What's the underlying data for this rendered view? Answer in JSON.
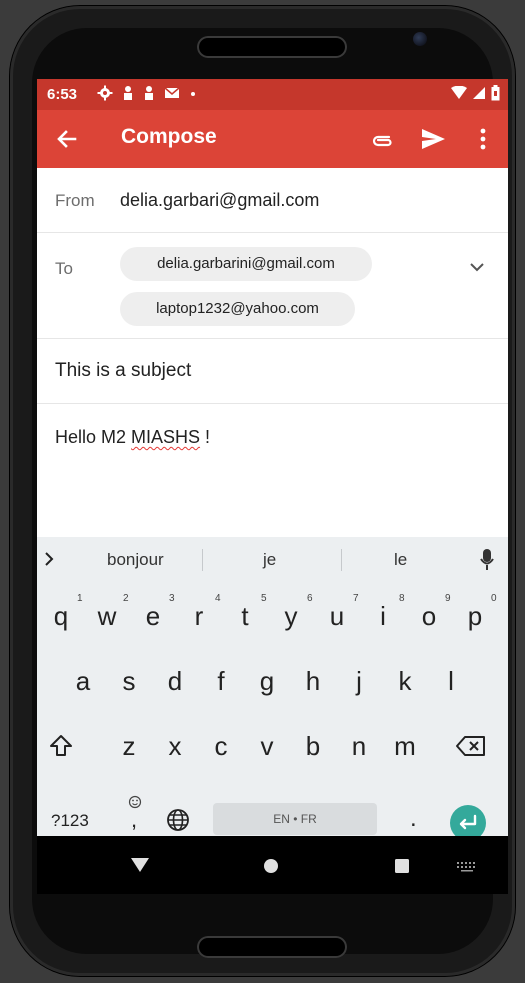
{
  "status_bar": {
    "time": "6:53"
  },
  "app_bar": {
    "title": "Compose"
  },
  "compose": {
    "from_label": "From",
    "from_value": "delia.garbari@gmail.com",
    "to_label": "To",
    "recipients": [
      "delia.garbarini@gmail.com",
      "laptop1232@yahoo.com"
    ],
    "subject": "This is a subject",
    "body_prefix": "Hello M2 ",
    "body_misspelled": "MIASHS",
    "body_suffix": " !"
  },
  "keyboard": {
    "suggestions": [
      "bonjour",
      "je",
      "le"
    ],
    "row1": [
      "q",
      "w",
      "e",
      "r",
      "t",
      "y",
      "u",
      "i",
      "o",
      "p"
    ],
    "row1_hints": [
      "1",
      "2",
      "3",
      "4",
      "5",
      "6",
      "7",
      "8",
      "9",
      "0"
    ],
    "row2": [
      "a",
      "s",
      "d",
      "f",
      "g",
      "h",
      "j",
      "k",
      "l"
    ],
    "row3": [
      "z",
      "x",
      "c",
      "v",
      "b",
      "n",
      "m"
    ],
    "symbols_key": "?123",
    "comma_key": ",",
    "period_key": ".",
    "space_label": "EN • FR"
  },
  "colors": {
    "status_bar": "#c5372c",
    "app_bar": "#dc4437",
    "enter_key": "#34a99b",
    "keyboard_bg": "#eceff1"
  }
}
